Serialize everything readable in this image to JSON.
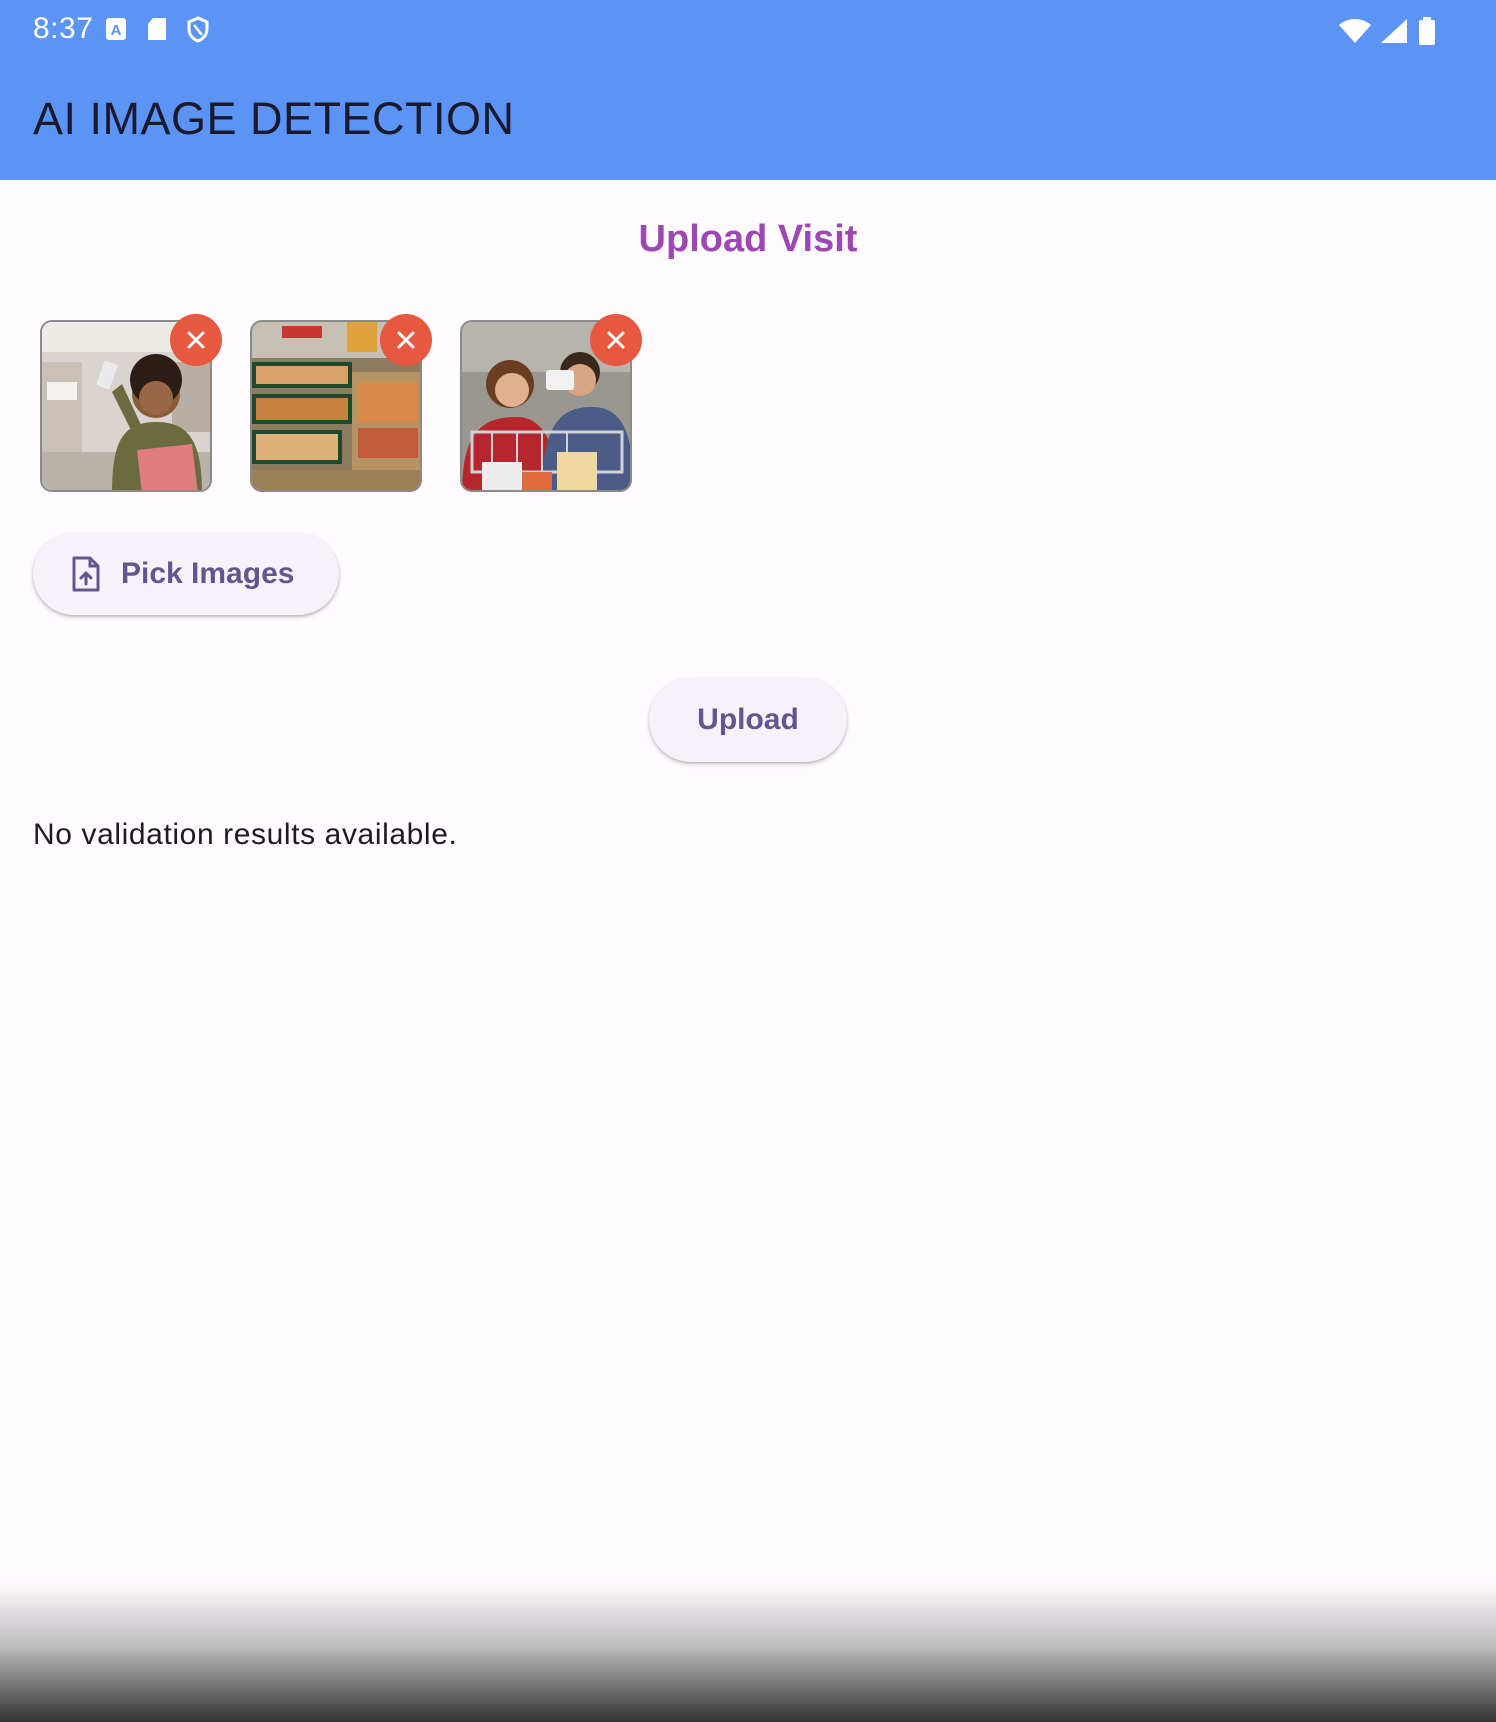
{
  "status_bar": {
    "time": "8:37",
    "left_icons": [
      "text-a-icon",
      "sd-card-icon",
      "shield-icon"
    ],
    "right_icons": [
      "wifi-icon",
      "cell-signal-icon",
      "battery-icon"
    ]
  },
  "app_bar": {
    "title": "AI IMAGE DETECTION",
    "background": "#5b94f5"
  },
  "heading": "Upload Visit",
  "thumbnails": [
    {
      "subject": "woman taking selfie with shopping bag in store"
    },
    {
      "subject": "supermarket produce aisle"
    },
    {
      "subject": "couple taking selfie with shopping cart"
    }
  ],
  "buttons": {
    "pick_images": "Pick Images",
    "upload": "Upload"
  },
  "message": "No validation results available.",
  "colors": {
    "accent": "#9c47b4",
    "remove": "#e8573f",
    "button_text": "#65558f"
  }
}
